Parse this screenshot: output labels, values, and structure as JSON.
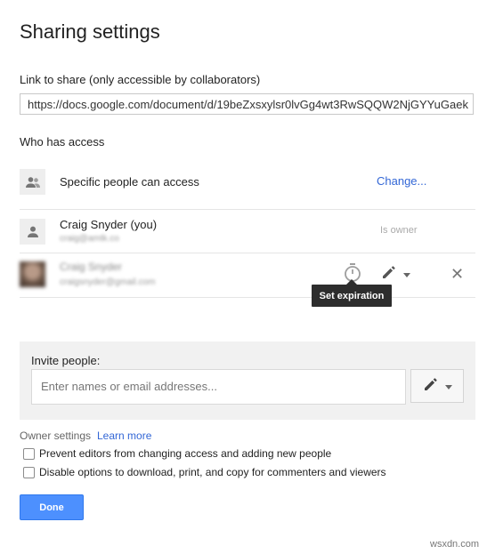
{
  "dialog": {
    "title": "Sharing settings"
  },
  "link": {
    "label": "Link to share (only accessible by collaborators)",
    "url": "https://docs.google.com/document/d/19beZxsxylsr0lvGg4wt3RwSQQW2NjGYYuGaek"
  },
  "access": {
    "heading": "Who has access",
    "general": {
      "label": "Specific people can access",
      "change_label": "Change...",
      "icon": "people-icon"
    },
    "people": [
      {
        "name": "Craig Snyder (you)",
        "email": "craig@amtk.co",
        "role": "Is owner",
        "icon": "person-icon"
      },
      {
        "name": "Craig Snyder",
        "email": "craigsnyder@gmail.com",
        "icon": "photo-avatar"
      }
    ],
    "tooltip": "Set expiration"
  },
  "invite": {
    "label": "Invite people:",
    "placeholder": "Enter names or email addresses..."
  },
  "owner_settings": {
    "label": "Owner settings",
    "learn_more": "Learn more",
    "options": [
      {
        "label": "Prevent editors from changing access and adding new people",
        "checked": false
      },
      {
        "label": "Disable options to download, print, and copy for commenters and viewers",
        "checked": false
      }
    ]
  },
  "footer": {
    "done_label": "Done"
  },
  "watermark": "wsxdn.com",
  "colors": {
    "link": "#3367d6",
    "primary_button": "#4d90fe",
    "tooltip_bg": "#2d2d2d"
  }
}
